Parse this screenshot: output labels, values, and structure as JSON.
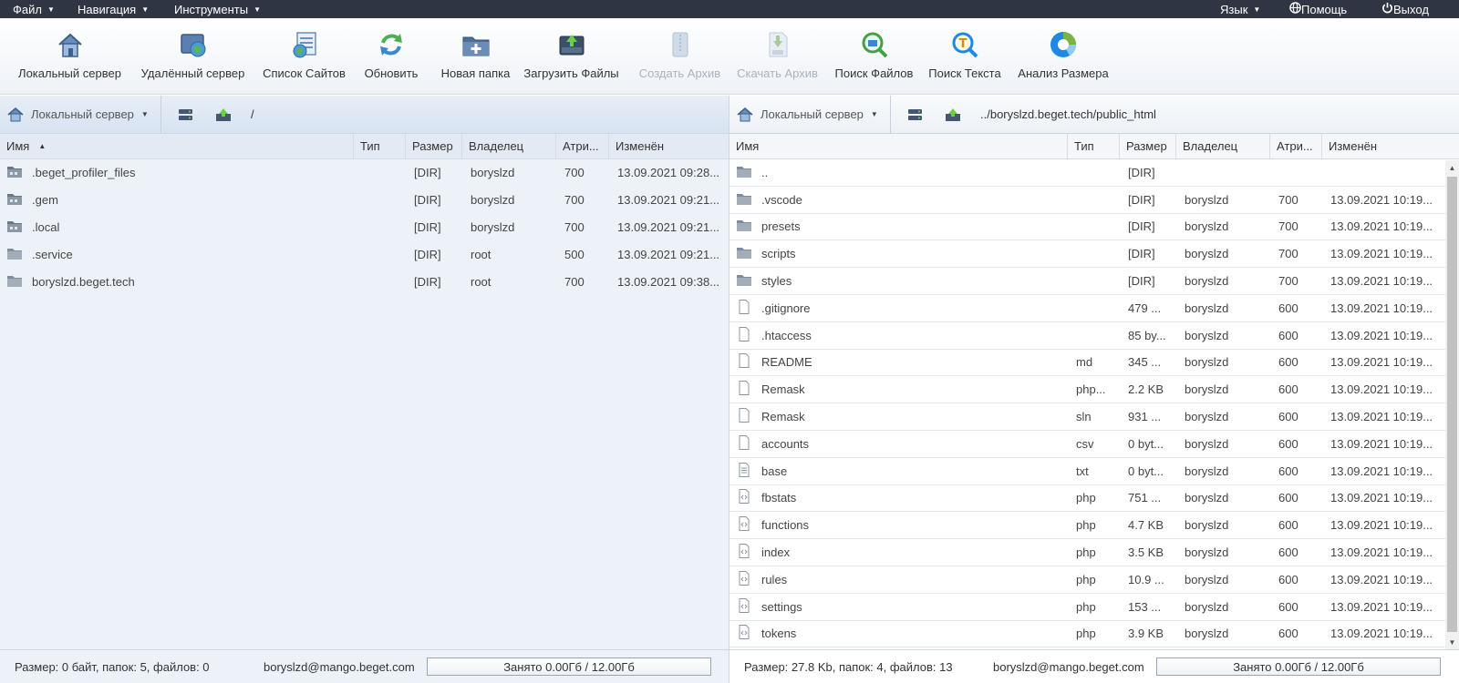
{
  "menubar": {
    "file": "Файл",
    "navigation": "Навигация",
    "tools": "Инструменты",
    "language": "Язык",
    "help": "Помощь",
    "exit": "Выход"
  },
  "toolbar": {
    "local_server": "Локальный сервер",
    "remote_server": "Удалённый сервер",
    "site_list": "Список Сайтов",
    "refresh": "Обновить",
    "new_folder": "Новая папка",
    "upload_files": "Загрузить Файлы",
    "create_archive": "Создать Архив",
    "download_archive": "Скачать Архив",
    "file_search": "Поиск Файлов",
    "text_search": "Поиск Текста",
    "size_analysis": "Анализ Размера"
  },
  "left_panel": {
    "server": "Локальный сервер",
    "path": "/",
    "columns": {
      "name": "Имя",
      "type": "Тип",
      "size": "Размер",
      "owner": "Владелец",
      "attrs": "Атри...",
      "modified": "Изменён"
    },
    "rows": [
      {
        "name": ".beget_profiler_files",
        "type": "",
        "size": "[DIR]",
        "owner": "boryslzd",
        "attrs": "700",
        "modified": "13.09.2021 09:28..."
      },
      {
        "name": ".gem",
        "type": "",
        "size": "[DIR]",
        "owner": "boryslzd",
        "attrs": "700",
        "modified": "13.09.2021 09:21..."
      },
      {
        "name": ".local",
        "type": "",
        "size": "[DIR]",
        "owner": "boryslzd",
        "attrs": "700",
        "modified": "13.09.2021 09:21..."
      },
      {
        "name": ".service",
        "type": "",
        "size": "[DIR]",
        "owner": "root",
        "attrs": "500",
        "modified": "13.09.2021 09:21..."
      },
      {
        "name": "boryslzd.beget.tech",
        "type": "",
        "size": "[DIR]",
        "owner": "root",
        "attrs": "700",
        "modified": "13.09.2021 09:38..."
      }
    ],
    "status": {
      "summary": "Размер: 0 байт, папок: 5, файлов: 0",
      "account": "boryslzd@mango.beget.com",
      "usage": "Занято 0.00Гб / 12.00Гб"
    }
  },
  "right_panel": {
    "server": "Локальный сервер",
    "path": "../boryslzd.beget.tech/public_html",
    "columns": {
      "name": "Имя",
      "type": "Тип",
      "size": "Размер",
      "owner": "Владелец",
      "attrs": "Атри...",
      "modified": "Изменён"
    },
    "rows": [
      {
        "icon": "folder",
        "name": "..",
        "type": "",
        "size": "[DIR]",
        "owner": "",
        "attrs": "",
        "modified": ""
      },
      {
        "icon": "folder",
        "name": ".vscode",
        "type": "",
        "size": "[DIR]",
        "owner": "boryslzd",
        "attrs": "700",
        "modified": "13.09.2021 10:19..."
      },
      {
        "icon": "folder",
        "name": "presets",
        "type": "",
        "size": "[DIR]",
        "owner": "boryslzd",
        "attrs": "700",
        "modified": "13.09.2021 10:19..."
      },
      {
        "icon": "folder",
        "name": "scripts",
        "type": "",
        "size": "[DIR]",
        "owner": "boryslzd",
        "attrs": "700",
        "modified": "13.09.2021 10:19..."
      },
      {
        "icon": "folder",
        "name": "styles",
        "type": "",
        "size": "[DIR]",
        "owner": "boryslzd",
        "attrs": "700",
        "modified": "13.09.2021 10:19..."
      },
      {
        "icon": "file",
        "name": ".gitignore",
        "type": "",
        "size": "479 ...",
        "owner": "boryslzd",
        "attrs": "600",
        "modified": "13.09.2021 10:19..."
      },
      {
        "icon": "file",
        "name": ".htaccess",
        "type": "",
        "size": "85 by...",
        "owner": "boryslzd",
        "attrs": "600",
        "modified": "13.09.2021 10:19..."
      },
      {
        "icon": "file",
        "name": "README",
        "type": "md",
        "size": "345 ...",
        "owner": "boryslzd",
        "attrs": "600",
        "modified": "13.09.2021 10:19..."
      },
      {
        "icon": "file",
        "name": "Remask",
        "type": "php...",
        "size": "2.2 KB",
        "owner": "boryslzd",
        "attrs": "600",
        "modified": "13.09.2021 10:19..."
      },
      {
        "icon": "file",
        "name": "Remask",
        "type": "sln",
        "size": "931 ...",
        "owner": "boryslzd",
        "attrs": "600",
        "modified": "13.09.2021 10:19..."
      },
      {
        "icon": "file",
        "name": "accounts",
        "type": "csv",
        "size": "0 byt...",
        "owner": "boryslzd",
        "attrs": "600",
        "modified": "13.09.2021 10:19..."
      },
      {
        "icon": "text",
        "name": "base",
        "type": "txt",
        "size": "0 byt...",
        "owner": "boryslzd",
        "attrs": "600",
        "modified": "13.09.2021 10:19..."
      },
      {
        "icon": "code",
        "name": "fbstats",
        "type": "php",
        "size": "751 ...",
        "owner": "boryslzd",
        "attrs": "600",
        "modified": "13.09.2021 10:19..."
      },
      {
        "icon": "code",
        "name": "functions",
        "type": "php",
        "size": "4.7 KB",
        "owner": "boryslzd",
        "attrs": "600",
        "modified": "13.09.2021 10:19..."
      },
      {
        "icon": "code",
        "name": "index",
        "type": "php",
        "size": "3.5 KB",
        "owner": "boryslzd",
        "attrs": "600",
        "modified": "13.09.2021 10:19..."
      },
      {
        "icon": "code",
        "name": "rules",
        "type": "php",
        "size": "10.9 ...",
        "owner": "boryslzd",
        "attrs": "600",
        "modified": "13.09.2021 10:19..."
      },
      {
        "icon": "code",
        "name": "settings",
        "type": "php",
        "size": "153 ...",
        "owner": "boryslzd",
        "attrs": "600",
        "modified": "13.09.2021 10:19..."
      },
      {
        "icon": "code",
        "name": "tokens",
        "type": "php",
        "size": "3.9 KB",
        "owner": "boryslzd",
        "attrs": "600",
        "modified": "13.09.2021 10:19..."
      }
    ],
    "status": {
      "summary": "Размер: 27.8 Kb, папок: 4, файлов: 13",
      "account": "boryslzd@mango.beget.com",
      "usage": "Занято 0.00Гб / 12.00Гб"
    }
  }
}
